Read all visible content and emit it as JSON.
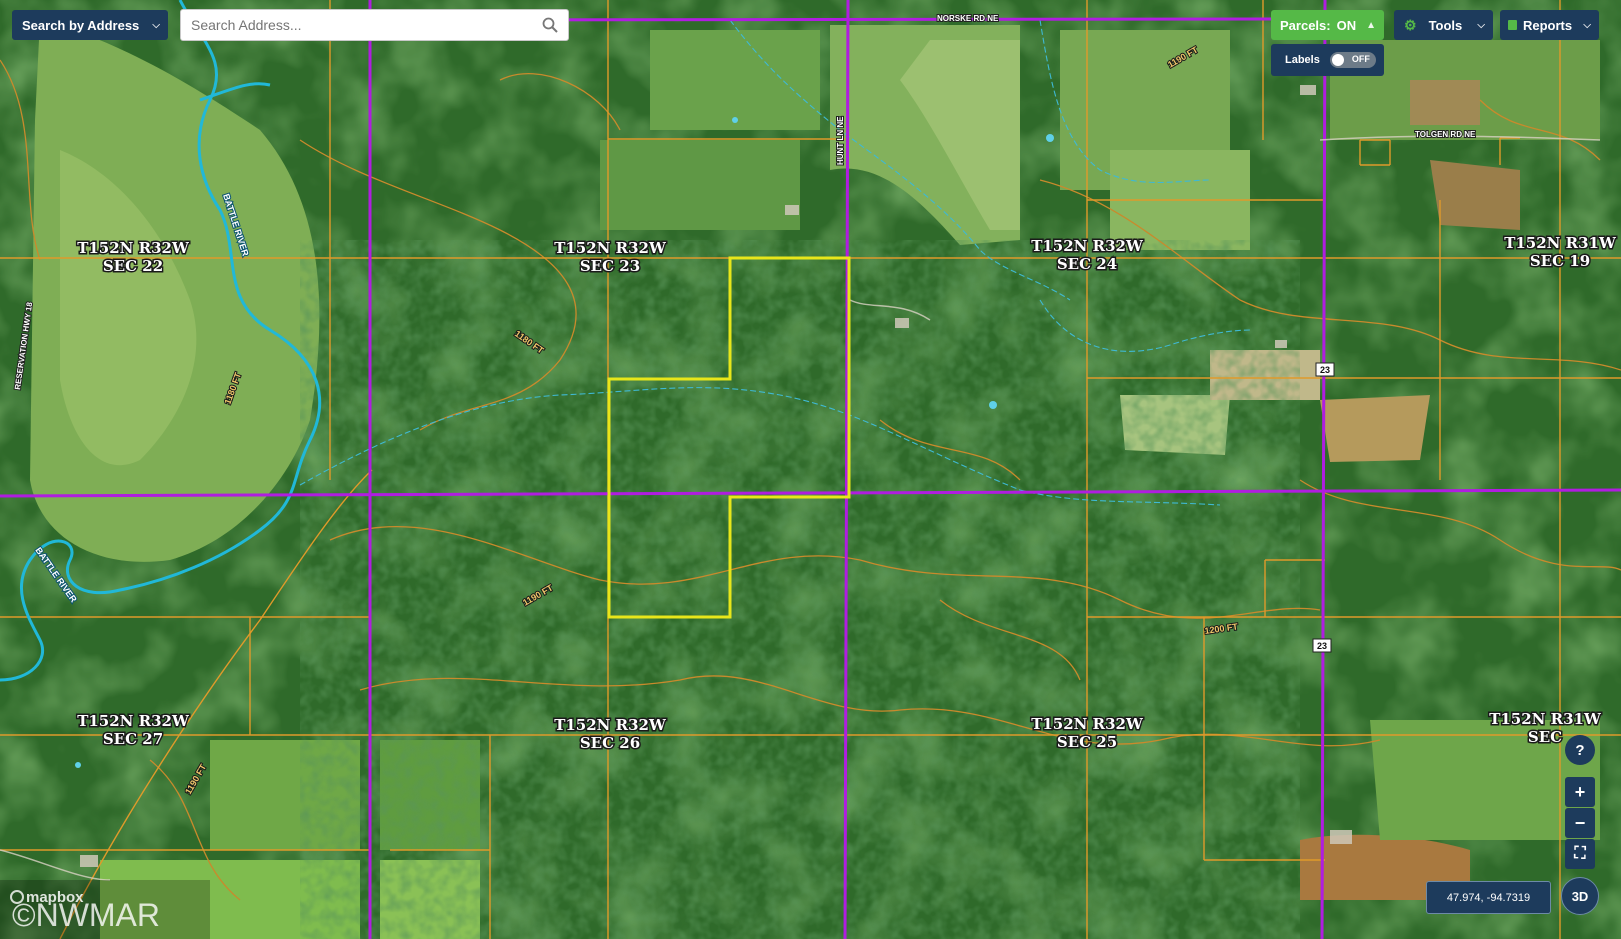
{
  "toolbar": {
    "search_mode_label": "Search by Address",
    "search_placeholder": "Search Address...",
    "parcels_label": "Parcels:",
    "parcels_state": "ON",
    "labels_label": "Labels",
    "labels_state": "OFF",
    "tools_label": "Tools",
    "reports_label": "Reports"
  },
  "map": {
    "sections": [
      {
        "line1": "T152N R32W",
        "line2": "SEC 22"
      },
      {
        "line1": "T152N R32W",
        "line2": "SEC 23"
      },
      {
        "line1": "T152N R32W",
        "line2": "SEC 24"
      },
      {
        "line1": "T152N R31W",
        "line2": "SEC 19"
      },
      {
        "line1": "T152N R32W",
        "line2": "SEC 27"
      },
      {
        "line1": "T152N R32W",
        "line2": "SEC 26"
      },
      {
        "line1": "T152N R32W",
        "line2": "SEC 25"
      },
      {
        "line1": "T152N R31W",
        "line2": "SEC"
      }
    ],
    "contour_labels": [
      "1190 FT",
      "1180 FT",
      "1180 FT",
      "1190 FT",
      "1200 FT",
      "1190 FT"
    ],
    "river_labels": [
      "BATTLE RIVER",
      "BATTLE RIVER"
    ],
    "road_labels": [
      "RESERVATION HWY 18",
      "NORSKE RD NE",
      "HUNT LN NE",
      "TOLGEN RD NE"
    ],
    "route_shields": [
      "23",
      "23"
    ]
  },
  "controls": {
    "help_glyph": "?",
    "zoom_in_glyph": "+",
    "zoom_out_glyph": "−",
    "fullscreen_glyph": "⛶",
    "coordinates": "47.974, -94.7319",
    "mode_3d_label": "3D"
  },
  "attribution": {
    "mapbox": "mapbox",
    "watermark": "©NWMAR"
  },
  "colors": {
    "township_lines": "#b01de0",
    "section_lines": "#e09a2a",
    "contours": "#c98a2c",
    "river": "#21b8d8",
    "stream": "#3fb9d3",
    "subject_parcel": "#e8e61a",
    "panel_dark": "#1d3b5c",
    "panel_green": "#55b947"
  }
}
